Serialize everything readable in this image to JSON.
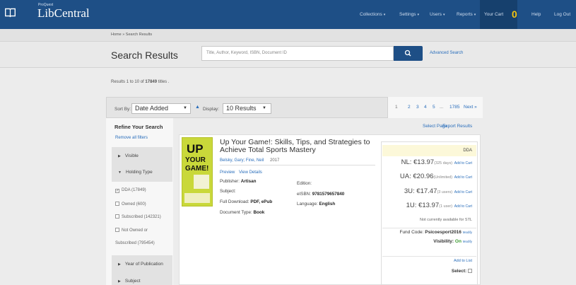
{
  "brand": {
    "small": "ProQuest",
    "name": "LibCentral"
  },
  "nav": {
    "collections": "Collections",
    "settings": "Settings",
    "users": "Users",
    "reports": "Reports",
    "cart_label": "Your Cart",
    "cart_count": "0",
    "help": "Help",
    "logout": "Log Out"
  },
  "breadcrumb": "Home » Search Results",
  "page_title": "Search Results",
  "search": {
    "placeholder": "Title, Author, Keyword, ISBN, Document ID",
    "advanced": "Advanced Search"
  },
  "results_summary": {
    "prefix": "Results ",
    "range": "1 to 10",
    "mid": " of ",
    "total": "17849",
    "suffix": " titles ."
  },
  "toolbar": {
    "sort_label": "Sort By:",
    "sort_value": "Date Added",
    "display_label": "Display:",
    "display_value": "10 Results"
  },
  "pagination": {
    "pages": [
      "1",
      "2",
      "3",
      "4",
      "5"
    ],
    "ellipsis": "...",
    "last": "1785",
    "next": "Next »"
  },
  "actions": {
    "select_page": "Select Page",
    "export": "Export Results"
  },
  "refine": {
    "title": "Refine Your Search",
    "remove_all": "Remove all filters",
    "facets": {
      "visible": "Visible",
      "holding_type": "Holding Type",
      "year": "Year of Publication",
      "subject": "Subject"
    },
    "holding_options": [
      {
        "label": "DDA (17849)",
        "checked": true
      },
      {
        "label": "Owned (600)",
        "checked": false
      },
      {
        "label": "Subscribed (142321)",
        "checked": false
      },
      {
        "label": "Not Owned or",
        "checked": false
      }
    ],
    "holding_wrap": "Subscribed (795454)"
  },
  "book": {
    "title": "Up Your Game!: Skills, Tips, and Strategies to Achieve Total Sports Mastery",
    "authors": "Belsky, Gary; Fine, Neil",
    "year": "2017",
    "preview": "Preview",
    "view_details": "View Details",
    "publisher_label": "Publisher:",
    "publisher": "Artisan",
    "subject_label": "Subject:",
    "full_download_label": "Full Download:",
    "full_download": "PDF, ePub",
    "doc_type_label": "Document Type:",
    "doc_type": "Book",
    "edition_label": "Edition:",
    "eisbn_label": "eISBN:",
    "eisbn": "9781579657840",
    "language_label": "Language:",
    "language": "English",
    "cover_text": {
      "line1": "UP",
      "line2": "YOUR",
      "line3": "GAME!"
    }
  },
  "pricing": {
    "tag": "DDA",
    "rows": [
      {
        "label": "NL: €13.97",
        "note": "(325 days)",
        "cart": "Add to Cart"
      },
      {
        "label": "UA: €20.96",
        "note": "(Unlimited)",
        "cart": "Add to Cart"
      },
      {
        "label": "3U: €17.47",
        "note": "(3 users)",
        "cart": "Add to Cart"
      },
      {
        "label": "1U: €13.97",
        "note": "(1 user)",
        "cart": "Add to Cart"
      }
    ],
    "not_available": "Not currently available for STL",
    "fund_code_label": "Fund Code:",
    "fund_code": "Psicoesport2016",
    "modify": "Modify",
    "visibility_label": "Visibility:",
    "visibility": "On",
    "add_to_list": "Add to List",
    "select_label": "Select:"
  },
  "colors": {
    "nav_bg": "#1e4f86",
    "cart_bg": "#16406d",
    "cart_badge": "#f3c512",
    "link": "#2a6ebb",
    "visible_on": "#3a9a2f",
    "dda_highlight": "#fcf8d9"
  }
}
